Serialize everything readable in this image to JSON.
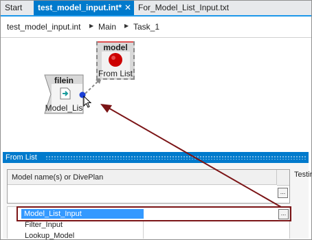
{
  "tabs": [
    {
      "label": "Start"
    },
    {
      "label": "test_model_input.int*",
      "close": "✕"
    },
    {
      "label": "For_Model_List_Input.txt"
    }
  ],
  "breadcrumb": [
    "test_model_input.int",
    "Main",
    "Task_1"
  ],
  "nodes": {
    "filein": {
      "title": "filein",
      "label": "Model_Lis"
    },
    "model": {
      "title": "model",
      "label": "From List"
    }
  },
  "panel": {
    "title": "From List",
    "column_header": "Model name(s) or DivePlan",
    "side_label": "Testir",
    "ellipsis": "...",
    "selected_value": "Model_List_Input",
    "options": [
      "Filter_Input",
      "Lookup_Model"
    ]
  },
  "colors": {
    "accent": "#007acc",
    "annotation": "#7b1416",
    "selection": "#3399ff",
    "model_node_dot": "#cc0000"
  }
}
